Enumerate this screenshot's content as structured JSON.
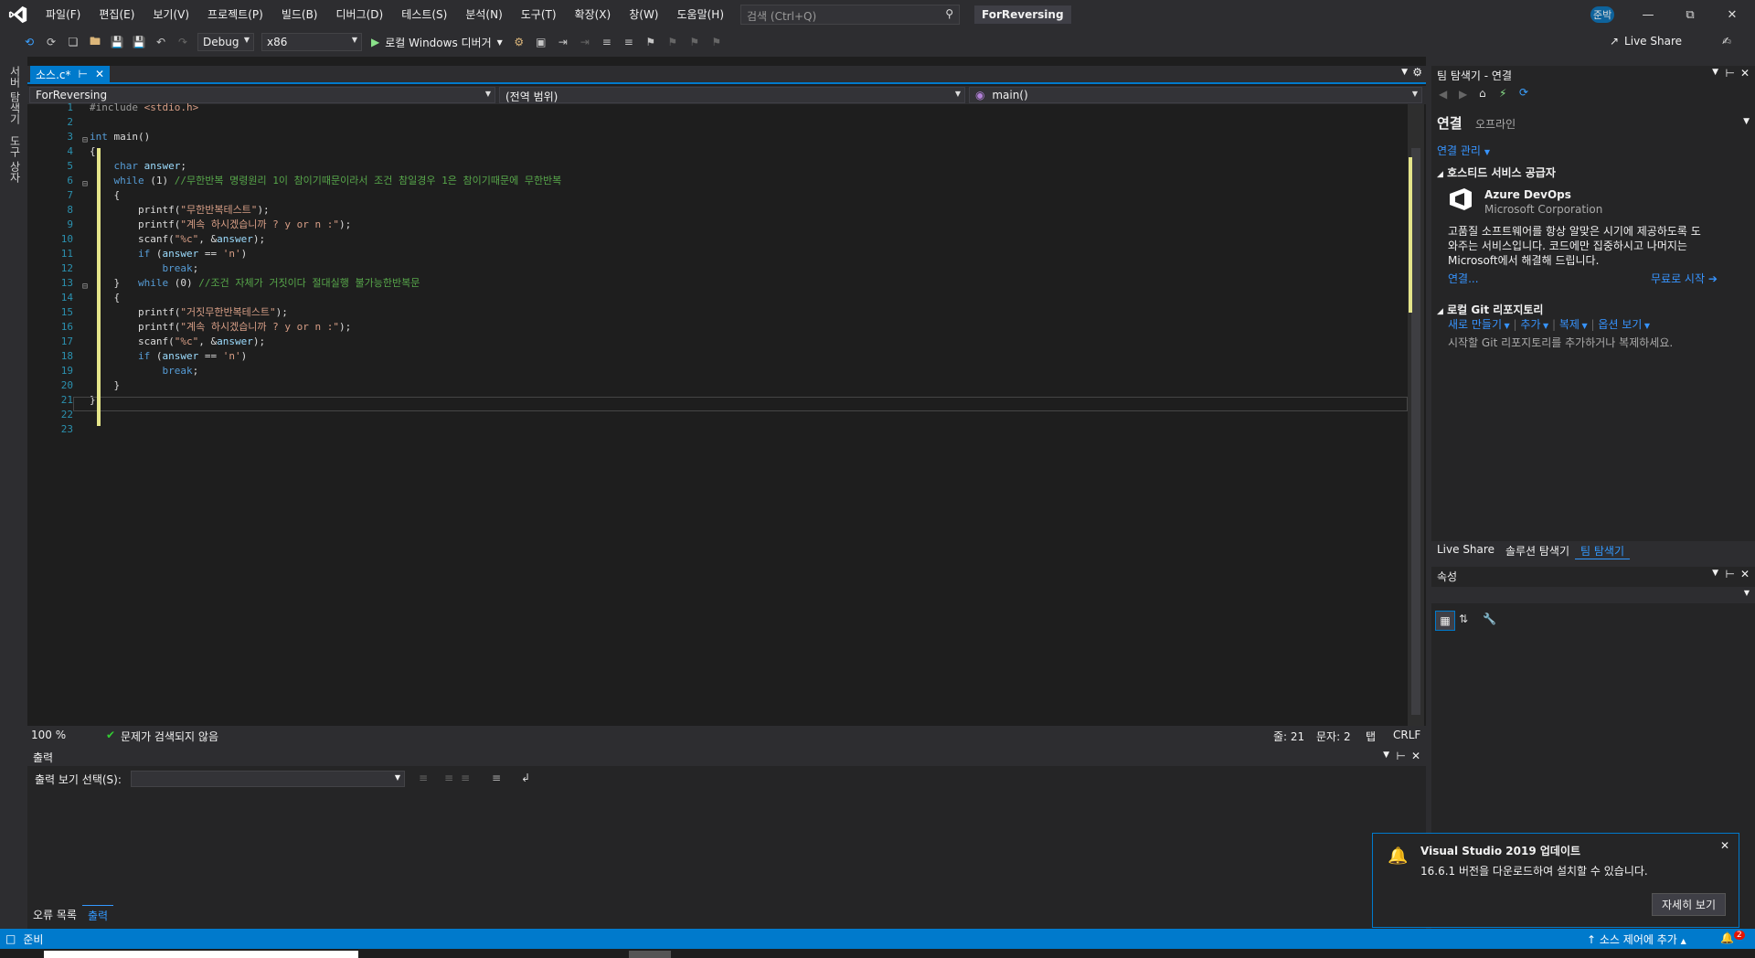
{
  "menubar": {
    "items": [
      "파일(F)",
      "편집(E)",
      "보기(V)",
      "프로젝트(P)",
      "빌드(B)",
      "디버그(D)",
      "테스트(S)",
      "분석(N)",
      "도구(T)",
      "확장(X)",
      "창(W)",
      "도움말(H)"
    ],
    "search_placeholder": "검색 (Ctrl+Q)",
    "solution_name": "ForReversing",
    "account": "준박"
  },
  "toolbar": {
    "configuration": "Debug",
    "platform": "x86",
    "run_label": "로컬 Windows 디버거",
    "live_share": "Live Share"
  },
  "left_sidebar": {
    "tabs": [
      "서버 탐색기",
      "도구 상자"
    ]
  },
  "document": {
    "tab_label": "소스.c*",
    "nav_project": "ForReversing",
    "nav_scope": "(전역 범위)",
    "nav_function": "main()",
    "lines": [
      "#include <stdio.h>",
      "",
      "int main()",
      "{",
      "    char answer;",
      "    while (1) //무한반복 명령원리 1이 참이기때문이라서 조건 참일경우 1은 참이기때문에 무한반복",
      "    {",
      "        printf(\"무한반복테스트\");",
      "        printf(\"계속 하시겠습니까 ? y or n :\");",
      "        scanf(\"%c\", &answer);",
      "        if (answer == 'n')",
      "            break;",
      "    }   while (0) //조건 자체가 거짓이다 절대실행 불가능한반복문",
      "    {",
      "        printf(\"거짓무한반복테스트\");",
      "        printf(\"계속 하시겠습니까 ? y or n :\");",
      "        scanf(\"%c\", &answer);",
      "        if (answer == 'n')",
      "            break;",
      "    }",
      "}",
      "",
      ""
    ]
  },
  "editor_status": {
    "zoom": "100 %",
    "issues": "문제가 검색되지 않음",
    "line": "줄: 21",
    "col": "문자: 2",
    "tab": "탭",
    "eol": "CRLF"
  },
  "output_panel": {
    "title": "출력",
    "show_from_label": "출력 보기 선택(S):"
  },
  "bottom_tabs": [
    "오류 목록",
    "출력"
  ],
  "team_explorer": {
    "title": "팀 탐색기 - 연결",
    "header": "연결",
    "status": "오프라인",
    "manage": "연결 관리",
    "hosted_title": "호스티드 서비스 공급자",
    "azure_name": "Azure DevOps",
    "azure_company": "Microsoft Corporation",
    "azure_desc_1": "고품질 소프트웨어를 항상 알맞은 시기에 제공하도록 도",
    "azure_desc_2": "와주는 서비스입니다. 코드에만 집중하시고 나머지는",
    "azure_desc_3": "Microsoft에서 해결해 드립니다.",
    "connect_link": "연결...",
    "free_start": "무료로 시작",
    "local_git_title": "로컬 Git 리포지토리",
    "git_new": "새로 만들기",
    "git_add": "추가",
    "git_clone": "복제",
    "git_options": "옵션 보기",
    "git_hint": "시작할 Git 리포지토리를 추가하거나 복제하세요.",
    "tabs": [
      "Live Share",
      "솔루션 탐색기",
      "팀 탐색기"
    ]
  },
  "properties": {
    "title": "속성"
  },
  "notification": {
    "title": "Visual Studio 2019 업데이트",
    "message": "16.6.1 버전을 다운로드하여 설치할 수 있습니다.",
    "button": "자세히 보기"
  },
  "statusbar": {
    "ready": "준비",
    "source_control": "소스 제어에 추가",
    "badge": "2"
  },
  "colors": {
    "accent": "#007acc",
    "bg": "#2d2d30",
    "editor_bg": "#1e1e1e",
    "keyword": "#569cd6",
    "string": "#d69d85",
    "comment": "#57a64a"
  }
}
